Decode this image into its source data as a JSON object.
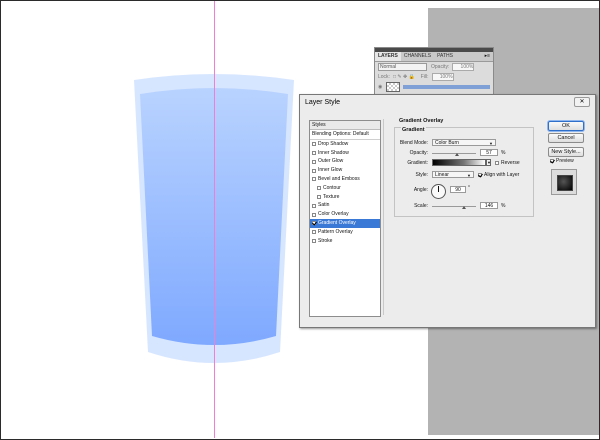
{
  "layers_panel": {
    "tabs": [
      "LAYERS",
      "CHANNELS",
      "PATHS"
    ],
    "menu_icon": "panel-menu-icon",
    "blend_mode": "Normal",
    "opacity_label": "Opacity:",
    "opacity_value": "100%",
    "lock_label": "Lock:",
    "fill_label": "Fill:",
    "fill_value": "100%"
  },
  "dialog": {
    "title": "Layer Style",
    "close_icon": "close-icon",
    "styles_list": {
      "header": "Styles",
      "items": [
        {
          "label": "Blending Options: Default",
          "checkbox": false,
          "checked": false,
          "indent": false,
          "active": false
        },
        {
          "label": "Drop Shadow",
          "checkbox": true,
          "checked": false,
          "indent": false,
          "active": false
        },
        {
          "label": "Inner Shadow",
          "checkbox": true,
          "checked": false,
          "indent": false,
          "active": false
        },
        {
          "label": "Outer Glow",
          "checkbox": true,
          "checked": false,
          "indent": false,
          "active": false
        },
        {
          "label": "Inner Glow",
          "checkbox": true,
          "checked": false,
          "indent": false,
          "active": false
        },
        {
          "label": "Bevel and Emboss",
          "checkbox": true,
          "checked": false,
          "indent": false,
          "active": false
        },
        {
          "label": "Contour",
          "checkbox": true,
          "checked": false,
          "indent": true,
          "active": false
        },
        {
          "label": "Texture",
          "checkbox": true,
          "checked": false,
          "indent": true,
          "active": false
        },
        {
          "label": "Satin",
          "checkbox": true,
          "checked": false,
          "indent": false,
          "active": false
        },
        {
          "label": "Color Overlay",
          "checkbox": true,
          "checked": false,
          "indent": false,
          "active": false
        },
        {
          "label": "Gradient Overlay",
          "checkbox": true,
          "checked": true,
          "indent": false,
          "active": true
        },
        {
          "label": "Pattern Overlay",
          "checkbox": true,
          "checked": false,
          "indent": false,
          "active": false
        },
        {
          "label": "Stroke",
          "checkbox": true,
          "checked": false,
          "indent": false,
          "active": false
        }
      ]
    },
    "gradient_overlay": {
      "section_title": "Gradient Overlay",
      "group_title": "Gradient",
      "blend_mode_label": "Blend Mode:",
      "blend_mode_value": "Color Burn",
      "opacity_label": "Opacity:",
      "opacity_value": "57",
      "opacity_unit": "%",
      "opacity_level": 0.57,
      "gradient_label": "Gradient:",
      "reverse_label": "Reverse",
      "reverse_checked": false,
      "style_label": "Style:",
      "style_value": "Linear",
      "align_label": "Align with Layer",
      "align_checked": true,
      "angle_label": "Angle:",
      "angle_value": "90",
      "angle_unit": "°",
      "scale_label": "Scale:",
      "scale_value": "146",
      "scale_unit": "%",
      "scale_level": 0.73
    },
    "buttons": {
      "ok": "OK",
      "cancel": "Cancel",
      "new_style": "New Style..."
    },
    "preview_label": "Preview",
    "preview_checked": true
  },
  "colors": {
    "guide": "#ee7fd3",
    "cup_light": "#d7e6ff",
    "cup_fill": "#8fb8ff",
    "selection": "#3b79d6"
  }
}
